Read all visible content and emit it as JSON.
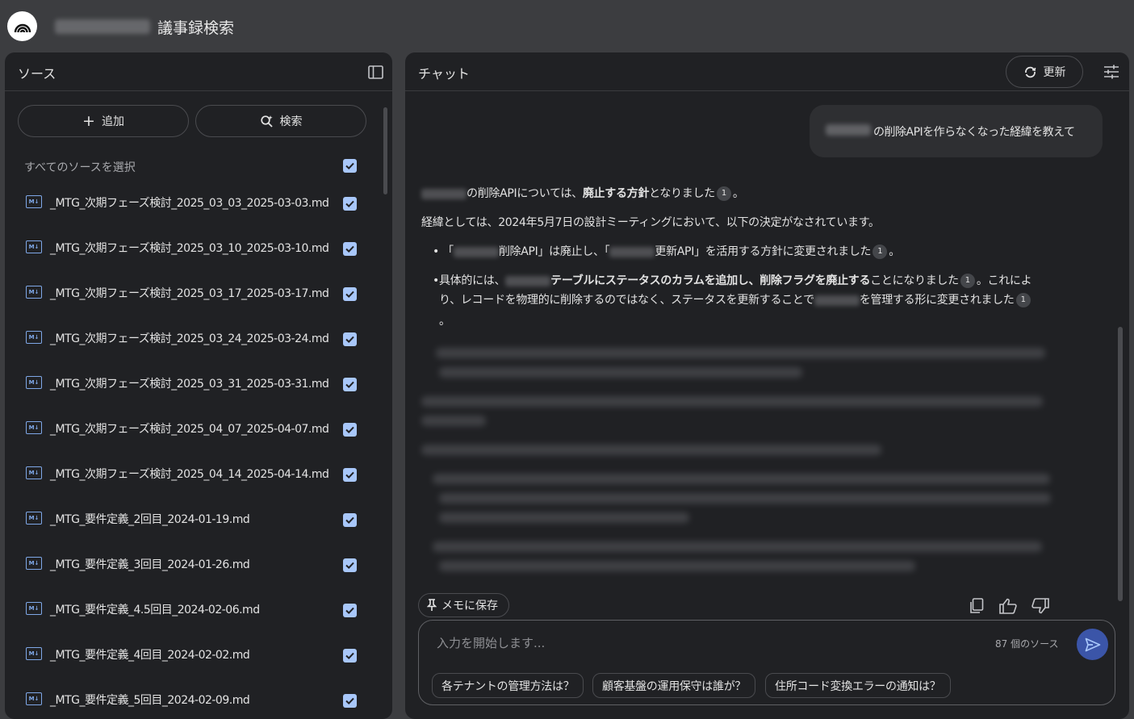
{
  "app": {
    "title": "議事録検索"
  },
  "sources_panel": {
    "title": "ソース",
    "add_label": "追加",
    "search_label": "検索",
    "select_all_label": "すべてのソースを選択",
    "items": [
      {
        "name": "_MTG_次期フェーズ検討_2025_03_03_2025-03-03.md",
        "checked": true
      },
      {
        "name": "_MTG_次期フェーズ検討_2025_03_10_2025-03-10.md",
        "checked": true
      },
      {
        "name": "_MTG_次期フェーズ検討_2025_03_17_2025-03-17.md",
        "checked": true
      },
      {
        "name": "_MTG_次期フェーズ検討_2025_03_24_2025-03-24.md",
        "checked": true
      },
      {
        "name": "_MTG_次期フェーズ検討_2025_03_31_2025-03-31.md",
        "checked": true
      },
      {
        "name": "_MTG_次期フェーズ検討_2025_04_07_2025-04-07.md",
        "checked": true
      },
      {
        "name": "_MTG_次期フェーズ検討_2025_04_14_2025-04-14.md",
        "checked": true
      },
      {
        "name": "_MTG_要件定義_2回目_2024-01-19.md",
        "checked": true
      },
      {
        "name": "_MTG_要件定義_3回目_2024-01-26.md",
        "checked": true
      },
      {
        "name": "_MTG_要件定義_4.5回目_2024-02-06.md",
        "checked": true
      },
      {
        "name": "_MTG_要件定義_4回目_2024-02-02.md",
        "checked": true
      },
      {
        "name": "_MTG_要件定義_5回目_2024-02-09.md",
        "checked": true
      }
    ]
  },
  "chat_panel": {
    "title": "チャット",
    "refresh_label": "更新",
    "user_message": "の削除APIを作らなくなった経緯を教えて",
    "answer": {
      "p1_a": "の削除APIについては、",
      "p1_b": "廃止する方針",
      "p1_c": "となりました",
      "p1_end": "。",
      "p2": "経緯としては、2024年5月7日の設計ミーティングにおいて、以下の決定がなされています。",
      "b1_a": "「",
      "b1_b": "削除API」は廃止し、「",
      "b1_c": "更新API」を活用する方針に変更されました",
      "b1_end": "。",
      "b2_a": "具体的には、",
      "b2_b": "テーブルにステータスのカラムを追加し、削除フラグを廃止する",
      "b2_c": "ことになりました",
      "b2_d": "。これによ",
      "b2_e": "り、レコードを物理的に削除するのではなく、ステータスを更新することで",
      "b2_f": "を管理する形に変更されました",
      "b2_end": "。",
      "citation": "1"
    },
    "memo_label": "メモに保存",
    "input_placeholder": "入力を開始します...",
    "source_count": "87 個のソース",
    "suggestions": [
      "各テナントの管理方法は？",
      "顧客基盤の運用保守は誰が？",
      "住所コード変換エラーの通知は？"
    ]
  },
  "colors": {
    "background": "#3c3d40",
    "panel": "#202124",
    "accent": "#a8c7fa",
    "send_button": "#3b55a8"
  }
}
